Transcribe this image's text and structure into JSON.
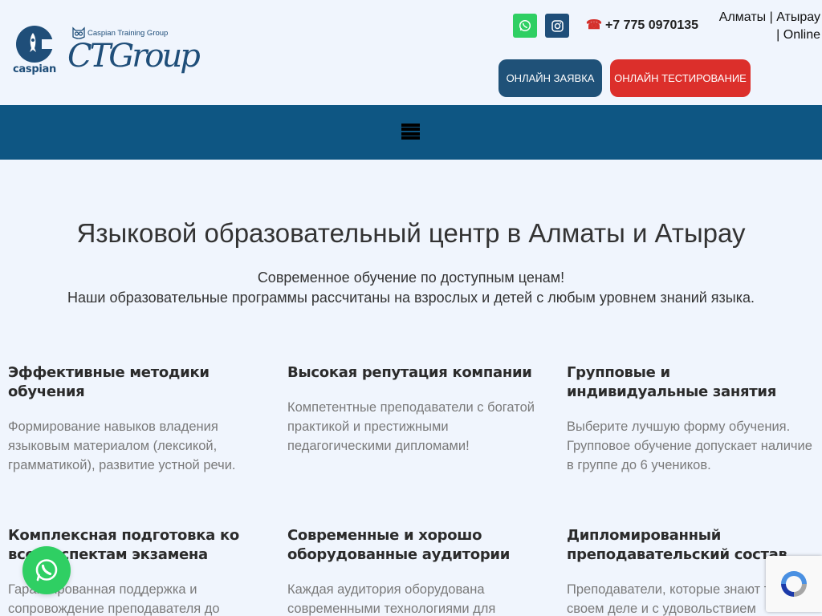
{
  "header": {
    "logo_caspian_text": "caspian",
    "logo_ctg_small": "Caspian Training Group",
    "logo_ctg_big": "CTGroup",
    "phone": "+7 775 0970135",
    "cities_line1": "Алматы | Атырау",
    "cities_line2": "| Online",
    "apply_button": "ОНЛАЙН ЗАЯВКА",
    "test_button": "ОНЛАЙН ТЕСТИРОВАНИЕ",
    "icons": [
      "whatsapp-icon",
      "instagram-icon",
      "phone-icon",
      "menu-icon"
    ]
  },
  "hero": {
    "title": "Языковой образовательный центр в Алматы и Атырау",
    "subtitle_line1": "Современное обучение по доступным ценам!",
    "subtitle_line2": "Наши образовательные программы рассчитаны на взрослых и детей с любым уровнем знаний языка."
  },
  "features": [
    {
      "title": "Эффективные методики обучения",
      "text": "Формирование навыков владения языковым материалом (лексикой, грамматикой), развитие устной речи."
    },
    {
      "title": "Высокая репутация компании",
      "text": "Компетентные преподаватели с богатой практикой и престижными педагогическими дипломами!"
    },
    {
      "title": "Групповые и индивидуальные занятия",
      "text": "Выберите лучшую форму обучения. Групповое обучение допускает наличие в группе до 6 учеников."
    },
    {
      "title": "Комплексная подготовка ко всем аспектам экзамена",
      "text": "Гарантированная поддержка и сопровождение преподавателя до"
    },
    {
      "title": "Современные и хорошо оборудованные аудитории",
      "text": "Каждая аудитория оборудована современными технологиями для"
    },
    {
      "title": "Дипломированный преподавательский состав",
      "text": "Преподаватели, которые знают толк в своем деле и с удовольствием"
    }
  ],
  "colors": {
    "brand_blue": "#1f4e79",
    "nav_blue": "#0e5683",
    "accent_red": "#dc2f2b",
    "whatsapp_green": "#2fcf63",
    "page_bg": "#f0f5fd"
  }
}
